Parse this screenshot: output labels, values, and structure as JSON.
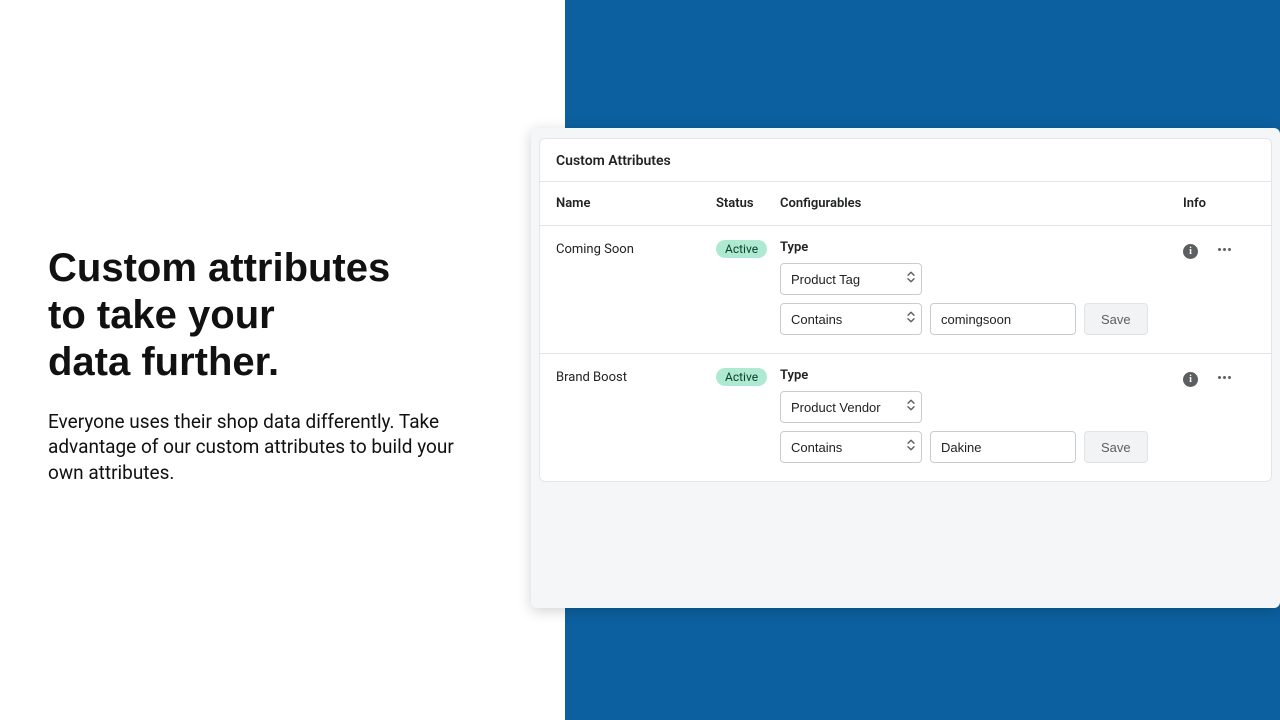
{
  "colors": {
    "brand_blue": "#0c609f",
    "badge_bg": "#aee9d1"
  },
  "marketing": {
    "headline_line1": "Custom attributes",
    "headline_line2": "to take your",
    "headline_line3": "data further.",
    "body": "Everyone uses their shop data differently. Take advantage of our custom attributes to build your own attributes."
  },
  "panel": {
    "title": "Custom Attributes",
    "columns": {
      "name": "Name",
      "status": "Status",
      "config": "Configurables",
      "info": "Info"
    },
    "type_label": "Type",
    "save_label": "Save",
    "rows": [
      {
        "name": "Coming Soon",
        "status": "Active",
        "type_value": "Product Tag",
        "operator_value": "Contains",
        "match_value": "comingsoon"
      },
      {
        "name": "Brand Boost",
        "status": "Active",
        "type_value": "Product Vendor",
        "operator_value": "Contains",
        "match_value": "Dakine"
      }
    ]
  }
}
